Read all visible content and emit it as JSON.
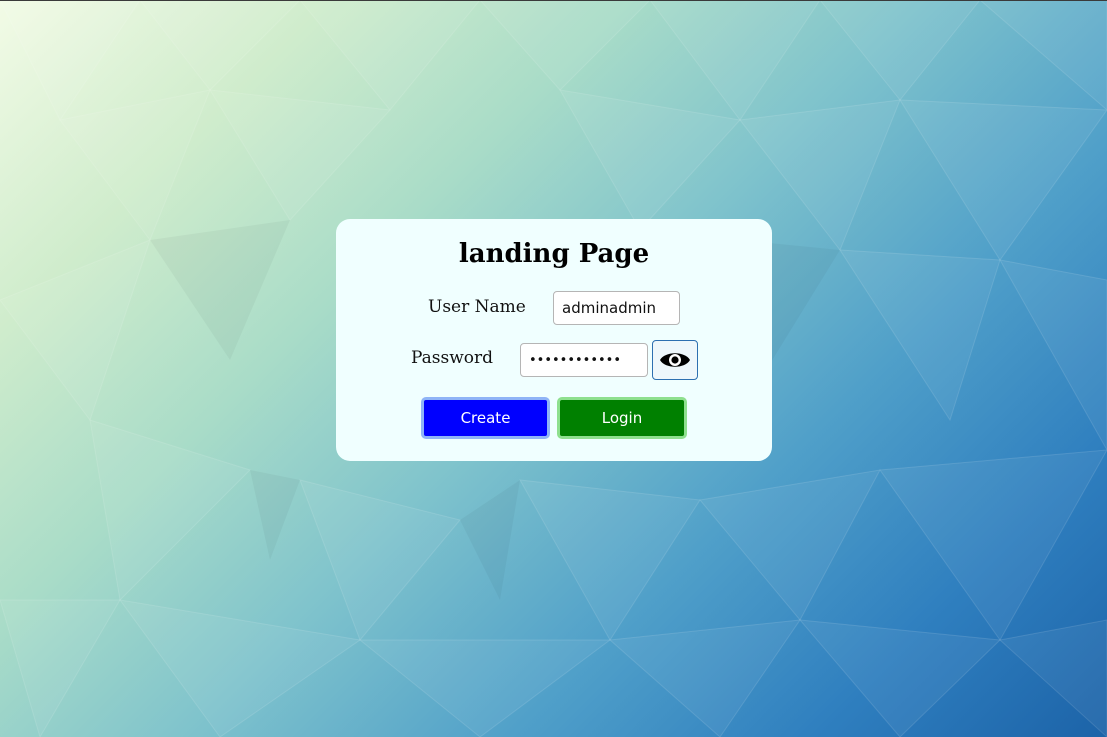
{
  "page": {
    "title": "landing Page"
  },
  "form": {
    "username_label": "User Name",
    "username_value": "adminadmin",
    "password_label": "Password",
    "password_value": "••••••••••••",
    "toggle_icon": "eye-icon",
    "create_label": "Create",
    "login_label": "Login"
  },
  "colors": {
    "card_bg": "#f0ffff",
    "create_bg": "#0000ff",
    "login_bg": "#008000"
  }
}
